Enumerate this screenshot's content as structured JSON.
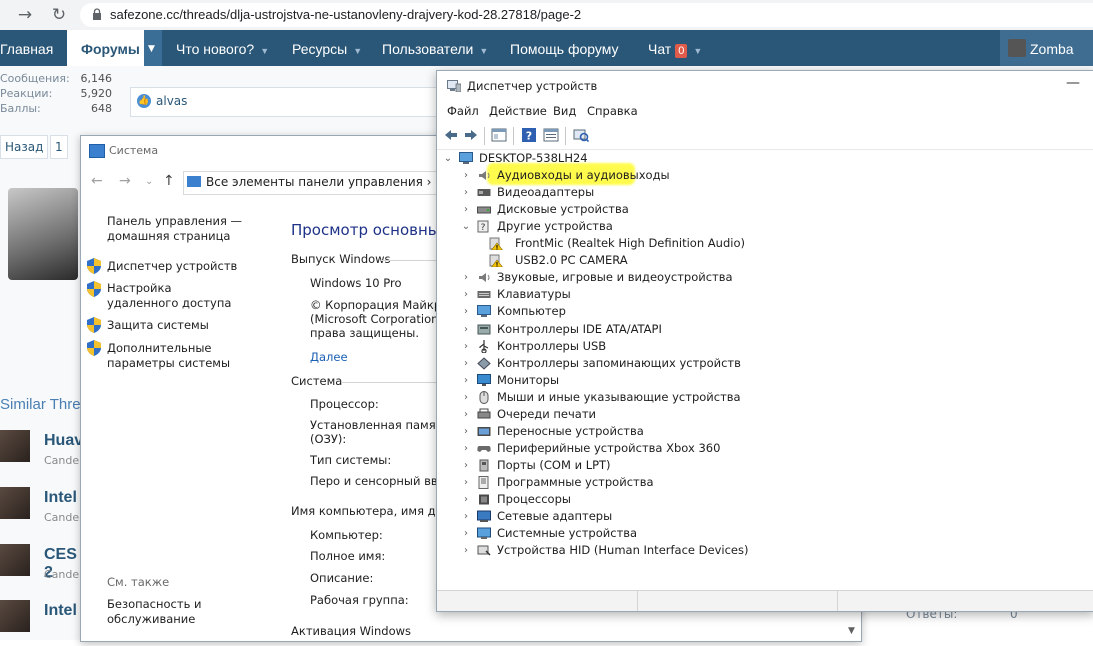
{
  "browser": {
    "url": "safezone.cc/threads/dlja-ustrojstva-ne-ustanovleny-drajvery-kod-28.27818/page-2"
  },
  "forum_nav": {
    "items": [
      {
        "label": "Главная"
      },
      {
        "label": "Форумы"
      },
      {
        "label": "Что нового?"
      },
      {
        "label": "Ресурсы"
      },
      {
        "label": "Пользователи"
      },
      {
        "label": "Помощь форуму"
      },
      {
        "label": "Чат"
      }
    ],
    "chat_badge": "0",
    "user": "Zomba",
    "colors": {
      "bar": "#2a5778",
      "badge": "#e05b49"
    }
  },
  "forum": {
    "stats": [
      {
        "label": "Сообщения:",
        "value": "6,146"
      },
      {
        "label": "Реакции:",
        "value": "5,920"
      },
      {
        "label": "Баллы:",
        "value": "648"
      }
    ],
    "liker": "alvas",
    "pager": [
      "Назад",
      "1"
    ],
    "similar_title": "Similar Thre",
    "threads": [
      {
        "title": "Huav",
        "sub": "Candel"
      },
      {
        "title": "Intel",
        "sub": "Candel"
      },
      {
        "title": "CES 2",
        "sub": "Candel"
      },
      {
        "title": "Intel",
        "sub": ""
      }
    ],
    "bottom_right": {
      "label": "Ответы:",
      "value": "0"
    }
  },
  "system_window": {
    "title": "Система",
    "address": "Все элементы панели управления  ›  Си",
    "sidebar": {
      "home": "Панель управления — домашняя страница",
      "links": [
        "Диспетчер устройств",
        "Настройка удаленного доступа",
        "Защита системы",
        "Дополнительные параметры системы"
      ],
      "see_also": "См. также",
      "see_also_links": [
        "Безопасность и обслуживание"
      ]
    },
    "main_title": "Просмотр основных с",
    "windows_edition": {
      "heading": "Выпуск Windows",
      "edition": "Windows 10 Pro",
      "copyright_1": "© Корпорация Майкрос",
      "copyright_2": "(Microsoft Corporation),",
      "copyright_3": "права защищены.",
      "more": "Далее"
    },
    "system": {
      "heading": "Система",
      "labels": [
        "Процессор:",
        "Установленная память",
        "(ОЗУ):",
        "Тип системы:",
        "Перо и сенсорный ввод:"
      ]
    },
    "computer": {
      "heading": "Имя компьютера, имя доме",
      "labels": [
        "Компьютер:",
        "Полное имя:",
        "Описание:",
        "Рабочая группа:"
      ]
    },
    "activation": {
      "heading": "Активация Windows"
    }
  },
  "device_manager": {
    "title": "Диспетчер устройств",
    "menu": [
      "Файл",
      "Действие",
      "Вид",
      "Справка"
    ],
    "root": "DESKTOP-538LH24",
    "highlight_color": "#fffb3a",
    "tree": [
      {
        "label": "Аудиовходы и аудиовыходы",
        "icon": "speaker-icon",
        "level": 1,
        "expanded": false
      },
      {
        "label": "Видеоадаптеры",
        "icon": "display-adapter-icon",
        "level": 1,
        "expanded": false
      },
      {
        "label": "Дисковые устройства",
        "icon": "disk-drive-icon",
        "level": 1,
        "expanded": false
      },
      {
        "label": "Другие устройства",
        "icon": "unknown-device-icon",
        "level": 1,
        "expanded": true
      },
      {
        "label": "FrontMic (Realtek High Definition Audio)",
        "icon": "warning-device-icon",
        "level": 2
      },
      {
        "label": "USB2.0 PC CAMERA",
        "icon": "warning-device-icon",
        "level": 2
      },
      {
        "label": "Звуковые, игровые и видеоустройства",
        "icon": "speaker-icon",
        "level": 1,
        "expanded": false
      },
      {
        "label": "Клавиатуры",
        "icon": "keyboard-icon",
        "level": 1,
        "expanded": false
      },
      {
        "label": "Компьютер",
        "icon": "computer-icon",
        "level": 1,
        "expanded": false
      },
      {
        "label": "Контроллеры IDE ATA/ATAPI",
        "icon": "ide-controller-icon",
        "level": 1,
        "expanded": false
      },
      {
        "label": "Контроллеры USB",
        "icon": "usb-icon",
        "level": 1,
        "expanded": false
      },
      {
        "label": "Контроллеры запоминающих устройств",
        "icon": "storage-controller-icon",
        "level": 1,
        "expanded": false
      },
      {
        "label": "Мониторы",
        "icon": "monitor-icon",
        "level": 1,
        "expanded": false
      },
      {
        "label": "Мыши и иные указывающие устройства",
        "icon": "mouse-icon",
        "level": 1,
        "expanded": false
      },
      {
        "label": "Очереди печати",
        "icon": "printer-icon",
        "level": 1,
        "expanded": false
      },
      {
        "label": "Переносные устройства",
        "icon": "portable-device-icon",
        "level": 1,
        "expanded": false
      },
      {
        "label": "Периферийные устройства Xbox 360",
        "icon": "gamepad-icon",
        "level": 1,
        "expanded": false
      },
      {
        "label": "Порты (COM и LPT)",
        "icon": "port-icon",
        "level": 1,
        "expanded": false
      },
      {
        "label": "Программные устройства",
        "icon": "software-device-icon",
        "level": 1,
        "expanded": false
      },
      {
        "label": "Процессоры",
        "icon": "cpu-icon",
        "level": 1,
        "expanded": false
      },
      {
        "label": "Сетевые адаптеры",
        "icon": "network-adapter-icon",
        "level": 1,
        "expanded": false
      },
      {
        "label": "Системные устройства",
        "icon": "system-device-icon",
        "level": 1,
        "expanded": false
      },
      {
        "label": "Устройства HID (Human Interface Devices)",
        "icon": "hid-icon",
        "level": 1,
        "expanded": false
      }
    ]
  }
}
